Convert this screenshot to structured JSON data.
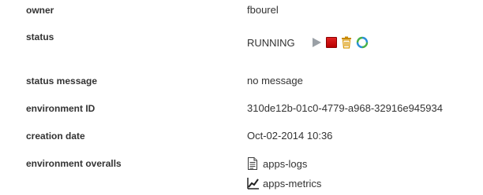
{
  "fields": {
    "owner": {
      "label": "owner",
      "value": "fbourel"
    },
    "status": {
      "label": "status",
      "value": "RUNNING"
    },
    "status_message": {
      "label": "status message",
      "value": "no message"
    },
    "environment_id": {
      "label": "environment ID",
      "value": "310de12b-01c0-4779-a968-32916e945934"
    },
    "creation_date": {
      "label": "creation date",
      "value": "Oct-02-2014 10:36"
    },
    "environment_overalls": {
      "label": "environment overalls",
      "links": [
        {
          "label": "apps-logs",
          "icon": "document-icon"
        },
        {
          "label": "apps-metrics",
          "icon": "chart-icon"
        }
      ]
    }
  },
  "controls": [
    {
      "name": "start",
      "icon": "play-icon",
      "color": "#9aa0a6"
    },
    {
      "name": "stop",
      "icon": "stop-icon",
      "color": "#cc0000"
    },
    {
      "name": "delete",
      "icon": "trash-icon",
      "color": "#e8a000"
    },
    {
      "name": "refresh",
      "icon": "refresh-icon",
      "color": "#2a8fd6"
    }
  ]
}
